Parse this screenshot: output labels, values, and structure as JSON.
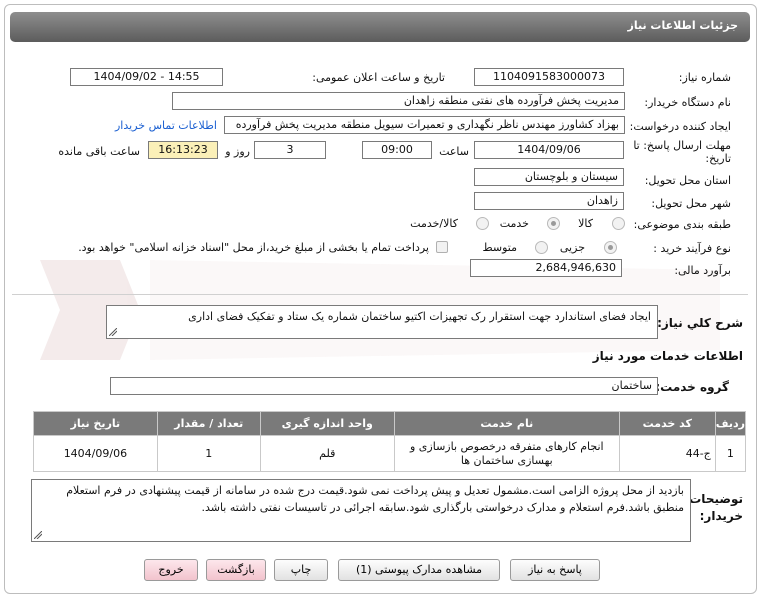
{
  "page": {
    "title": "جزئیات اطلاعات نیاز"
  },
  "form": {
    "need_number_label": "شماره نیاز:",
    "need_number": "1104091583000073",
    "announce_label": "تاریخ و ساعت اعلان عمومی:",
    "announce_value": "1404/09/02 - 14:55",
    "buyer_org_label": "نام دستگاه خریدار:",
    "buyer_org": "مدیریت پخش فرآورده های نفتی منطقه زاهدان",
    "creator_label": "ایجاد کننده درخواست:",
    "creator": "بهزاد کشاورز مهندس ناظر نگهداری و تعمیرات سیویل منطقه  مدیریت پخش فرآورده",
    "contact_link": "اطلاعات تماس خریدار",
    "deadline_label_1": "مهلت ارسال پاسخ: تا",
    "deadline_label_2": "تاریخ:",
    "deadline_date": "1404/09/06",
    "time_label": "ساعت",
    "deadline_time": "09:00",
    "days_value": "3",
    "days_label": "روز و",
    "remaining_time": "16:13:23",
    "remaining_label": "ساعت باقی مانده",
    "province_label": "استان محل تحویل:",
    "province": "سیستان و بلوچستان",
    "city_label": "شهر محل تحویل:",
    "city": "زاهدان",
    "category_label": "طبقه بندی موضوعی:",
    "category_options": [
      "کالا",
      "خدمت",
      "کالا/خدمت"
    ],
    "category_selected": "خدمت",
    "process_label": "نوع فرآیند خرید :",
    "process_options": [
      "جزیی",
      "متوسط"
    ],
    "process_selected": "جزیی",
    "payment_note": "پرداخت تمام یا بخشی از مبلغ خرید،از محل \"اسناد خزانه اسلامی\" خواهد بود.",
    "estimate_label": "برآورد مالی:",
    "estimate_value": "2,684,946,630"
  },
  "summary": {
    "label": "شرح کلي نياز:",
    "text": "ایجاد فضای استاندارد جهت استقرار رک تجهیزات اکتیو ساختمان شماره یک ستاد و تفکیک فضای اداری"
  },
  "services": {
    "heading": "اطلاعات خدمات مورد نیاز",
    "group_label": "گروه خدمت:",
    "group_value": "ساختمان",
    "columns": [
      "ردیف",
      "کد خدمت",
      "نام خدمت",
      "واحد اندازه گیری",
      "تعداد / مقدار",
      "تاریخ نیاز"
    ],
    "rows": [
      [
        "1",
        "ج-44",
        "انجام کارهای متفرقه درخصوص بازسازی و بهسازی ساختمان ها",
        "قلم",
        "1",
        "1404/09/06"
      ]
    ]
  },
  "notes": {
    "label_1": "توضیحات",
    "label_2": "خریدار:",
    "text": "بازدید از محل پروژه الزامی است.مشمول تعدیل و پیش پرداخت نمی شود.قیمت درج شده در سامانه از قیمت پیشنهادی در فرم استعلام منطبق باشد.فرم استعلام و مدارک درخواستی بارگذاری شود.سابقه اجرائی در تاسیسات نفتی داشته باشد."
  },
  "buttons": {
    "reply": "پاسخ به نیاز",
    "attachments": "مشاهده مدارک پیوستی (1)",
    "print": "چاپ",
    "back": "بازگشت",
    "exit": "خروج"
  },
  "colors": {
    "title_bar": "#6e6e6e",
    "link": "#1a5fd1",
    "yellow_field": "#fbf0b8",
    "table_header": "#7a7a7a",
    "button_pink": "#f2c3cd"
  }
}
